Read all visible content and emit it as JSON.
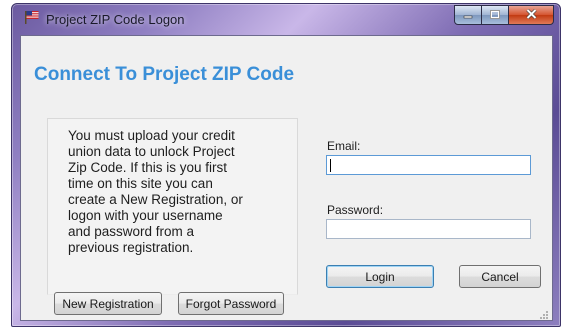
{
  "window": {
    "title": "Project ZIP Code Logon",
    "controls": {
      "minimize_icon": "minimize-icon",
      "maximize_icon": "maximize-icon",
      "close_icon": "close-icon"
    }
  },
  "main": {
    "heading": "Connect To Project ZIP Code",
    "info_lines": [
      "You must upload your credit",
      "union data to unlock Project",
      "Zip Code. If this is you first",
      "time on this site you can",
      "create a New Registration, or",
      "logon with your username",
      "and password from a",
      "previous registration."
    ]
  },
  "form": {
    "email_label": "Email:",
    "email_value": "",
    "password_label": "Password:",
    "password_value": ""
  },
  "buttons": {
    "login": "Login",
    "cancel": "Cancel",
    "new_registration": "New Registration",
    "forgot_password": "Forgot Password"
  },
  "colors": {
    "heading": "#3a8fd8",
    "client_bg": "#f0f0f0",
    "close_button": "#c23a12"
  }
}
